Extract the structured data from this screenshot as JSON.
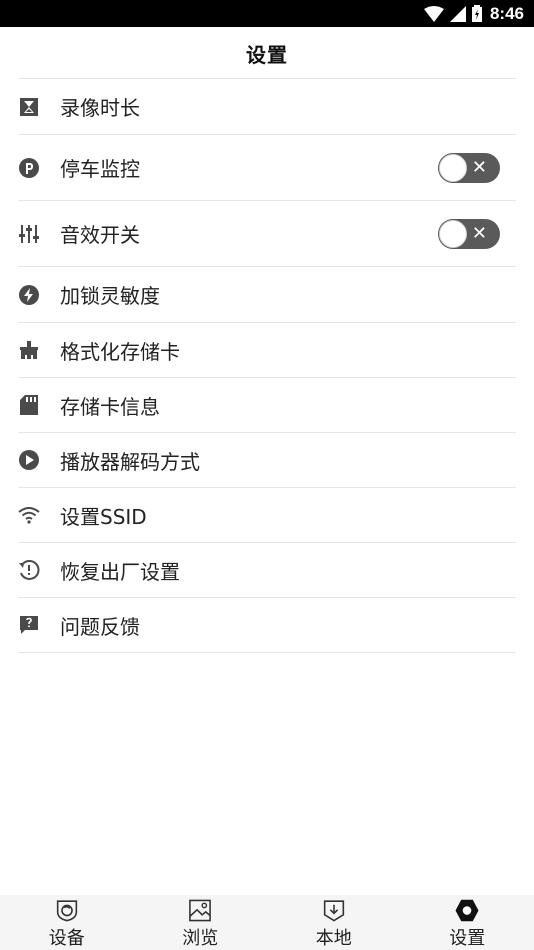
{
  "status_bar": {
    "time": "8:46"
  },
  "header": {
    "title": "设置"
  },
  "settings": [
    {
      "label": "录像时长",
      "icon": "hourglass-icon",
      "toggle": null
    },
    {
      "label": "停车监控",
      "icon": "parking-icon",
      "toggle": "off"
    },
    {
      "label": "音效开关",
      "icon": "equalizer-icon",
      "toggle": "off"
    },
    {
      "label": "加锁灵敏度",
      "icon": "lightning-icon",
      "toggle": null
    },
    {
      "label": "格式化存储卡",
      "icon": "eraser-icon",
      "toggle": null
    },
    {
      "label": "存储卡信息",
      "icon": "sd-card-icon",
      "toggle": null
    },
    {
      "label": "播放器解码方式",
      "icon": "play-circle-icon",
      "toggle": null
    },
    {
      "label": "设置SSID",
      "icon": "wifi-icon",
      "toggle": null
    },
    {
      "label": "恢复出厂设置",
      "icon": "restore-icon",
      "toggle": null
    },
    {
      "label": "问题反馈",
      "icon": "feedback-icon",
      "toggle": null
    }
  ],
  "toggle_off_glyph": "✕",
  "tabs": [
    {
      "label": "设备",
      "icon": "device-icon"
    },
    {
      "label": "浏览",
      "icon": "gallery-icon"
    },
    {
      "label": "本地",
      "icon": "download-icon"
    },
    {
      "label": "设置",
      "icon": "settings-hexagon-icon",
      "active": true
    }
  ]
}
